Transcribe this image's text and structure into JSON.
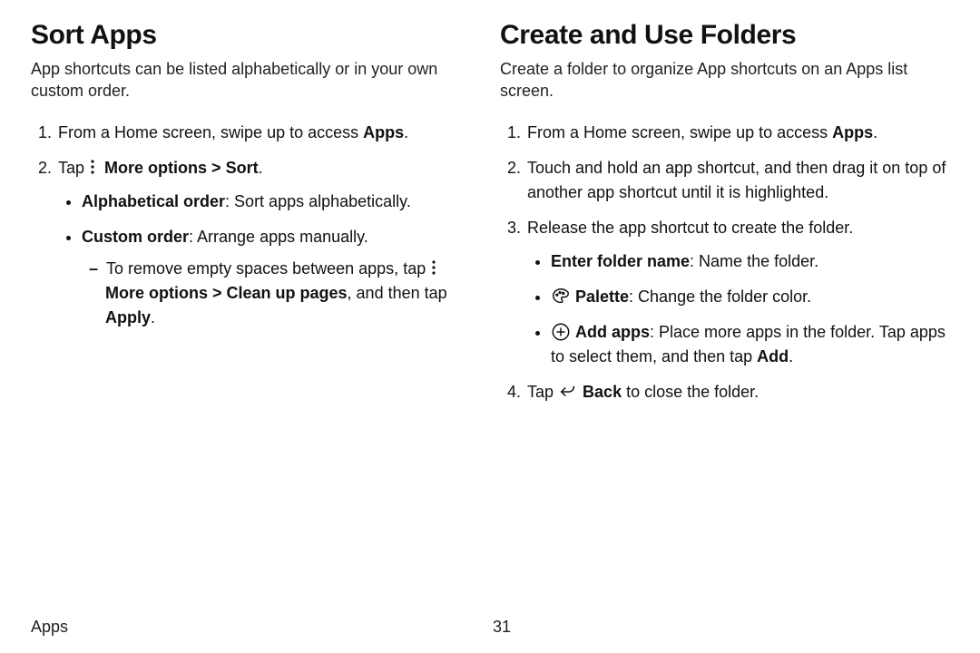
{
  "footer": {
    "section": "Apps",
    "page_number": "31"
  },
  "left": {
    "heading": "Sort Apps",
    "intro": "App shortcuts can be listed alphabetically or in your own custom order.",
    "step1_pre": "From a Home screen, swipe up to access ",
    "step1_bold": "Apps",
    "step1_post": ".",
    "step2_pre": "Tap ",
    "step2_more_options": "More options",
    "step2_caret": " > ",
    "step2_sort": "Sort",
    "step2_post": ".",
    "bullet_alpha_label": "Alphabetical order",
    "bullet_alpha_desc": ": Sort apps alphabetically.",
    "bullet_custom_label": "Custom order",
    "bullet_custom_desc": ": Arrange apps manually.",
    "dash_pre": "To remove empty spaces between apps, tap ",
    "dash_more_options": "More options",
    "dash_caret": " > ",
    "dash_cleanup": "Clean up pages",
    "dash_mid": ", and then tap ",
    "dash_apply": "Apply",
    "dash_post": "."
  },
  "right": {
    "heading": "Create and Use Folders",
    "intro": "Create a folder to organize App shortcuts on an Apps list screen.",
    "step1_pre": "From a Home screen, swipe up to access ",
    "step1_bold": "Apps",
    "step1_post": ".",
    "step2": "Touch and hold an app shortcut, and then drag it on top of another app shortcut until it is highlighted.",
    "step3": "Release the app shortcut to create the folder.",
    "bullet_name_label": "Enter folder name",
    "bullet_name_desc": ": Name the folder.",
    "bullet_palette_label": "Palette",
    "bullet_palette_desc": ": Change the folder color.",
    "bullet_add_label": "Add apps",
    "bullet_add_desc_1": ": Place more apps in the folder. Tap apps to select them, and then tap ",
    "bullet_add_desc_bold": "Add",
    "bullet_add_desc_2": ".",
    "step4_pre": "Tap ",
    "step4_back": "Back",
    "step4_post": " to close the folder."
  }
}
